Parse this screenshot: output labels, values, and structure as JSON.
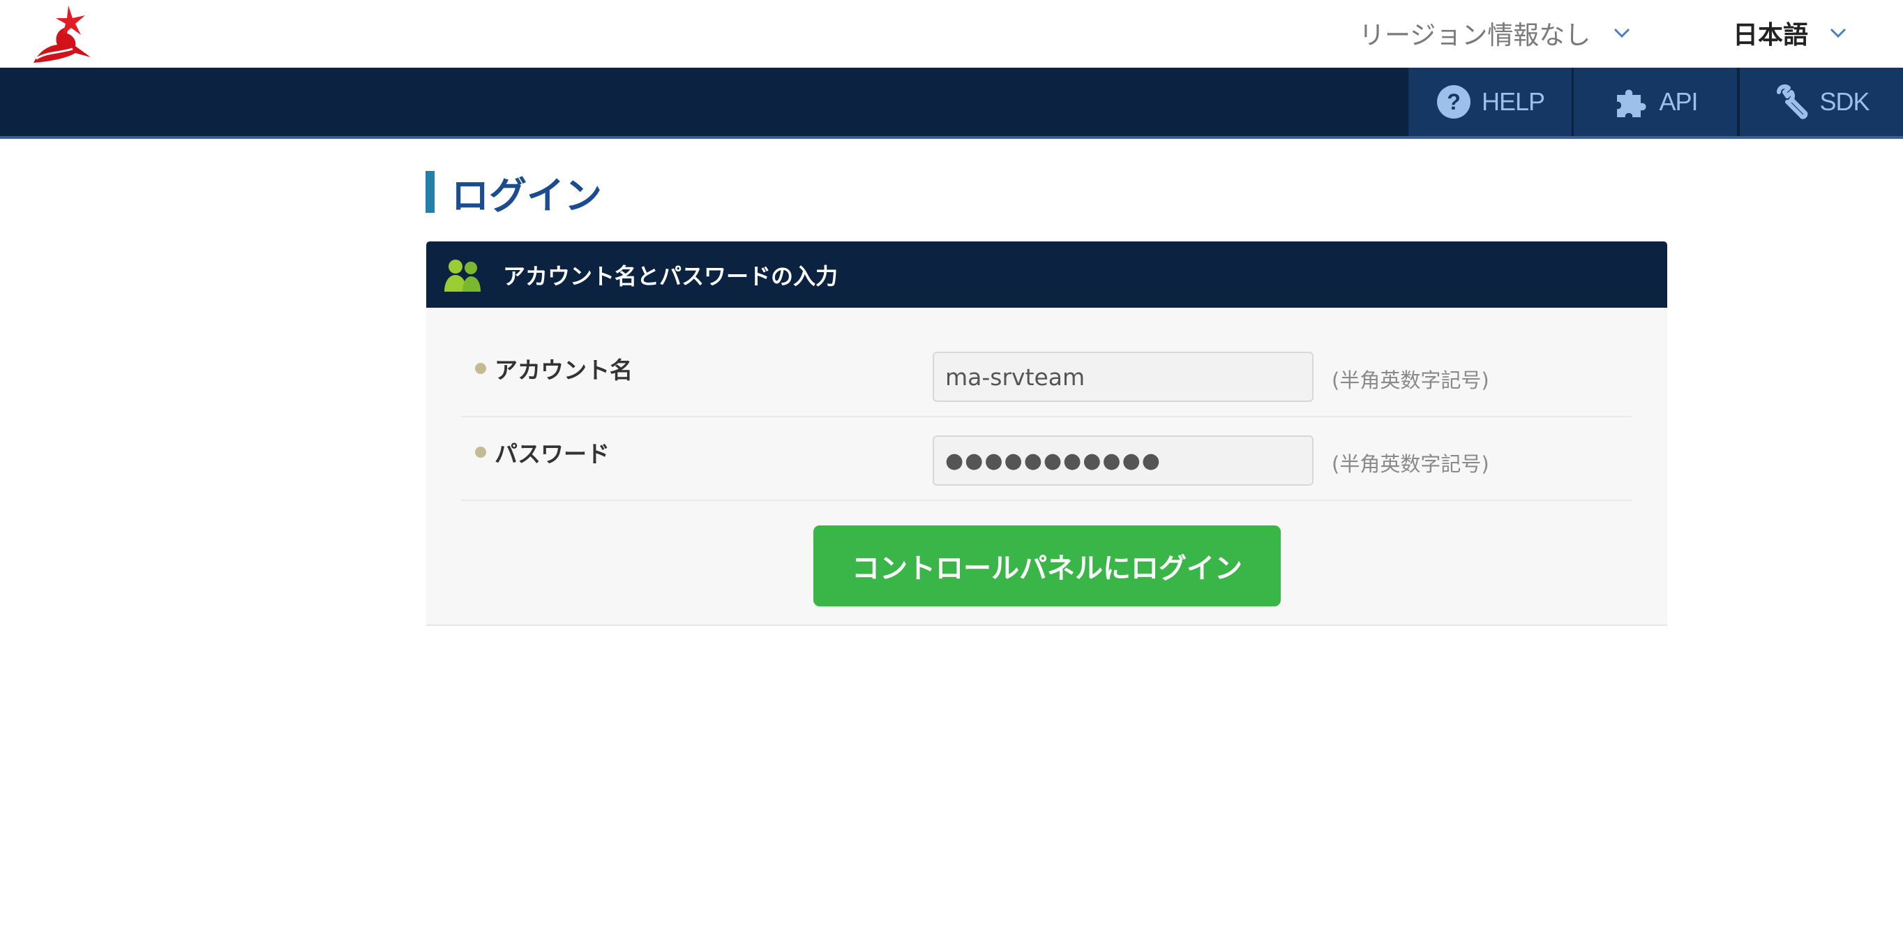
{
  "header": {
    "logo_icon": "red-dragon-logo-icon",
    "region_selector": {
      "label": "リージョン情報なし",
      "icon": "chevron-down-icon"
    },
    "language_selector": {
      "label": "日本語",
      "icon": "chevron-down-icon"
    }
  },
  "nav": {
    "help": {
      "label": "HELP",
      "icon": "question-circle-icon"
    },
    "api": {
      "label": "API",
      "icon": "puzzle-piece-icon"
    },
    "sdk": {
      "label": "SDK",
      "icon": "wrench-icon"
    }
  },
  "page": {
    "title": "ログイン"
  },
  "panel": {
    "title": "アカウント名とパスワードの入力",
    "icon": "users-icon",
    "fields": {
      "account": {
        "label": "アカウント名",
        "value": "ma-srvteam",
        "hint": "(半角英数字記号)"
      },
      "password": {
        "label": "パスワード",
        "value": "●●●●●●●●●●●",
        "hint": "(半角英数字記号)"
      }
    },
    "submit_label": "コントロールパネルにログイン"
  },
  "colors": {
    "nav_bg": "#0b2240",
    "nav_button_bg": "#143763",
    "title_blue": "#1b4c8f",
    "login_green": "#3ab649"
  }
}
